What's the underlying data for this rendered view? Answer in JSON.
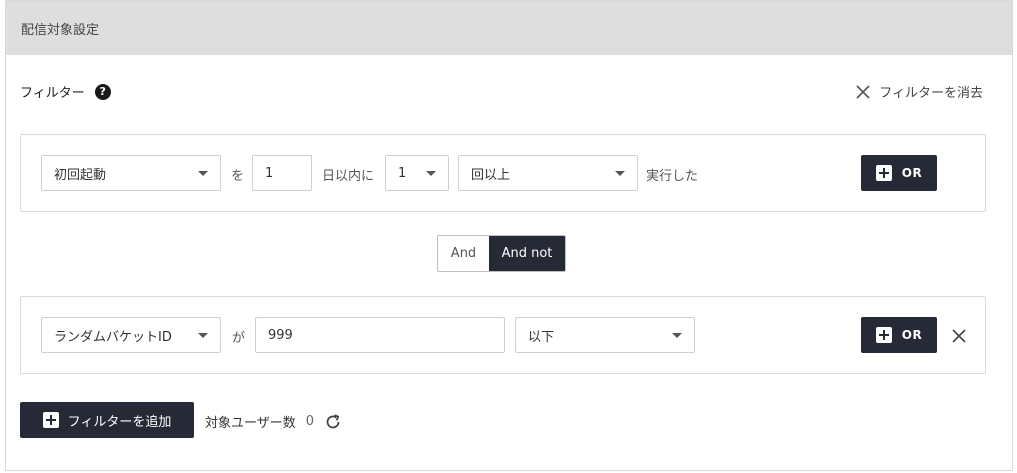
{
  "header": {
    "title": "配信対象設定"
  },
  "filters_section": {
    "label": "フィルター",
    "help_icon": "?",
    "clear_label": "フィルターを消去"
  },
  "filter1": {
    "event_select": "初回起動",
    "particle_wo": "を",
    "days_value": "1",
    "days_suffix": "日以内に",
    "count_select": "1",
    "count_condition_select": "回以上",
    "executed_text": "実行した",
    "or_label": "OR"
  },
  "logic_toggle": {
    "and_label": "And",
    "and_not_label": "And not",
    "selected": "And not"
  },
  "filter2": {
    "property_select": "ランダムバケットID",
    "particle_ga": "が",
    "value_input": "999",
    "condition_select": "以下",
    "or_label": "OR"
  },
  "footer": {
    "add_filter_label": "フィルターを追加",
    "target_users_label": "対象ユーザー数",
    "target_users_count": "0"
  },
  "colors": {
    "header_bg": "#dedede",
    "dark_button": "#262a36",
    "border": "#d9d9d9"
  },
  "icons": {
    "help": "question-circle-icon",
    "clear": "close-icon",
    "plus": "plus-square-icon",
    "remove": "close-icon",
    "refresh": "refresh-icon",
    "caret": "caret-down-icon"
  }
}
